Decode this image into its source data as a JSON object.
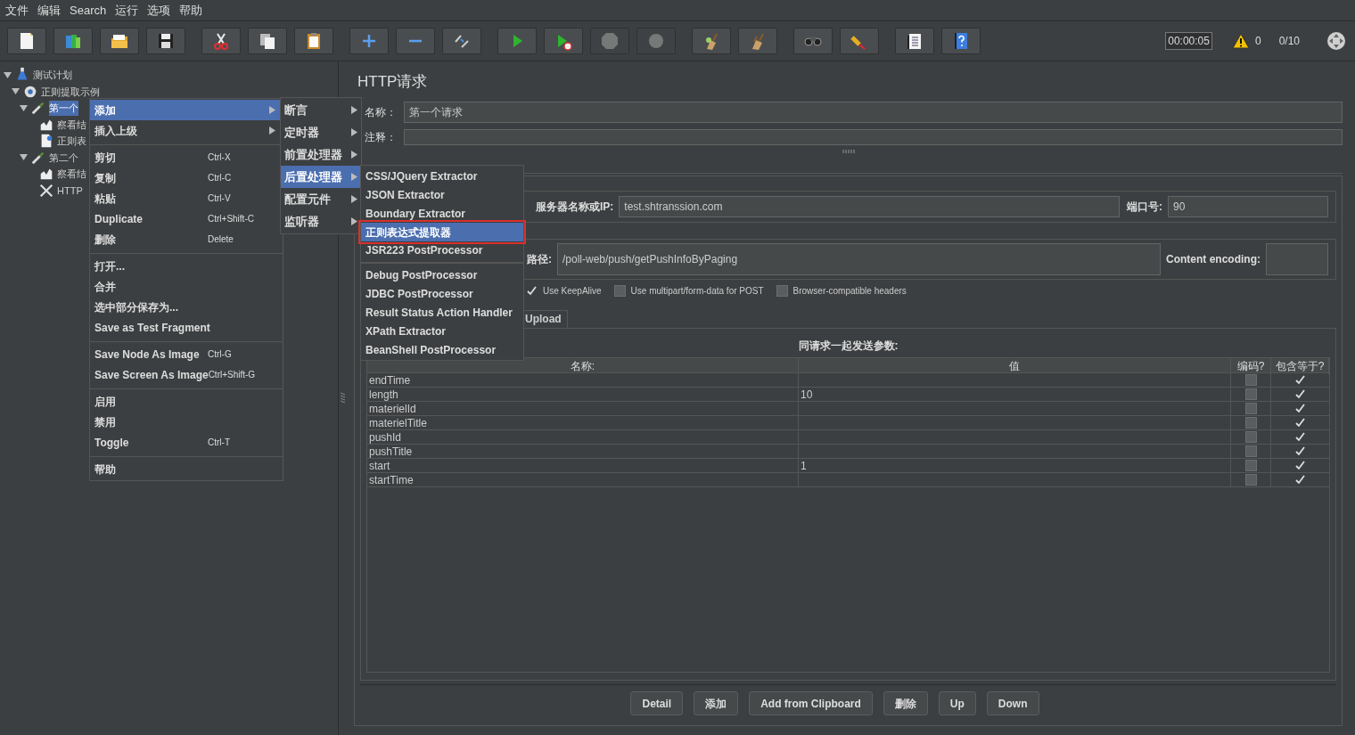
{
  "menu_bar": [
    {
      "label": "文件"
    },
    {
      "label": "编辑"
    },
    {
      "label": "Search"
    },
    {
      "label": "运行"
    },
    {
      "label": "选项"
    },
    {
      "label": "帮助"
    }
  ],
  "toolbar": [
    [
      {
        "kind": "new",
        "disabled": false
      },
      {
        "kind": "templates",
        "disabled": false
      },
      {
        "kind": "open",
        "disabled": false
      },
      {
        "kind": "save",
        "disabled": false
      }
    ],
    [
      {
        "kind": "cut",
        "disabled": false
      },
      {
        "kind": "copy",
        "disabled": false
      },
      {
        "kind": "paste",
        "disabled": false
      }
    ],
    [
      {
        "kind": "expand",
        "disabled": false
      },
      {
        "kind": "collapse",
        "disabled": false
      },
      {
        "kind": "toggle",
        "disabled": false
      }
    ],
    [
      {
        "kind": "start",
        "disabled": false
      },
      {
        "kind": "start-no-timers",
        "disabled": false
      },
      {
        "kind": "stop",
        "disabled": true
      },
      {
        "kind": "shutdown",
        "disabled": true
      }
    ],
    [
      {
        "kind": "clear",
        "disabled": false
      },
      {
        "kind": "clear-all",
        "disabled": false
      }
    ],
    [
      {
        "kind": "search",
        "disabled": false
      },
      {
        "kind": "reset",
        "disabled": false
      }
    ],
    [
      {
        "kind": "functions",
        "disabled": false
      },
      {
        "kind": "help",
        "disabled": false
      }
    ]
  ],
  "status": {
    "timer": "00:00:05",
    "warnings": "0",
    "threads": "0/10"
  },
  "tree": [
    {
      "label": "测试计划",
      "kind": "plan",
      "expanded": true,
      "selected": false,
      "children": [
        {
          "label": "正则提取示例",
          "kind": "thread-group",
          "expanded": true,
          "selected": false,
          "children": [
            {
              "label": "第一个",
              "kind": "sampler",
              "expanded": true,
              "selected": true,
              "children": [
                {
                  "label": "察看结",
                  "kind": "listener",
                  "selected": false
                },
                {
                  "label": "正则表",
                  "kind": "extractor",
                  "selected": false
                }
              ]
            },
            {
              "label": "第二个",
              "kind": "sampler",
              "expanded": true,
              "selected": false,
              "children": [
                {
                  "label": "察看结",
                  "kind": "listener",
                  "selected": false
                },
                {
                  "label": "HTTP",
                  "kind": "config",
                  "selected": false
                }
              ]
            }
          ]
        }
      ]
    }
  ],
  "context_menu": [
    {
      "kind": "submenu",
      "label": "添加",
      "selected": true
    },
    {
      "kind": "submenu",
      "label": "插入上级",
      "selected": false
    },
    {
      "kind": "separator"
    },
    {
      "kind": "item",
      "label": "剪切",
      "shortcut": "Ctrl-X",
      "selected": false
    },
    {
      "kind": "item",
      "label": "复制",
      "shortcut": "Ctrl-C",
      "selected": false
    },
    {
      "kind": "item",
      "label": "粘贴",
      "shortcut": "Ctrl-V",
      "selected": false
    },
    {
      "kind": "item",
      "label": "Duplicate",
      "shortcut": "Ctrl+Shift-C",
      "selected": false
    },
    {
      "kind": "item",
      "label": "删除",
      "shortcut": "Delete",
      "selected": false
    },
    {
      "kind": "separator"
    },
    {
      "kind": "item",
      "label": "打开...",
      "selected": false
    },
    {
      "kind": "item",
      "label": "合并",
      "selected": false
    },
    {
      "kind": "item",
      "label": "选中部分保存为...",
      "selected": false
    },
    {
      "kind": "item",
      "label": "Save as Test Fragment",
      "selected": false
    },
    {
      "kind": "separator"
    },
    {
      "kind": "item",
      "label": "Save Node As Image",
      "shortcut": "Ctrl-G",
      "selected": false
    },
    {
      "kind": "item",
      "label": "Save Screen As Image",
      "shortcut": "Ctrl+Shift-G",
      "selected": false
    },
    {
      "kind": "separator"
    },
    {
      "kind": "item",
      "label": "启用",
      "selected": false
    },
    {
      "kind": "item",
      "label": "禁用",
      "selected": false
    },
    {
      "kind": "item",
      "label": "Toggle",
      "shortcut": "Ctrl-T",
      "selected": false
    },
    {
      "kind": "separator"
    },
    {
      "kind": "item",
      "label": "帮助",
      "selected": false
    }
  ],
  "add_submenu": [
    {
      "label": "断言",
      "selected": false
    },
    {
      "label": "定时器",
      "selected": false
    },
    {
      "label": "前置处理器",
      "selected": false
    },
    {
      "label": "后置处理器",
      "selected": true
    },
    {
      "label": "配置元件",
      "selected": false
    },
    {
      "label": "监听器",
      "selected": false
    }
  ],
  "post_processor_menu": [
    {
      "label": "CSS/JQuery Extractor",
      "selected": false,
      "annotated": false
    },
    {
      "label": "JSON Extractor",
      "selected": false,
      "annotated": false
    },
    {
      "label": "Boundary Extractor",
      "selected": false,
      "annotated": false
    },
    {
      "label": "正则表达式提取器",
      "selected": true,
      "annotated": true
    },
    {
      "label": "JSR223 PostProcessor",
      "selected": false,
      "annotated": false,
      "separator_after": true
    },
    {
      "label": "Debug PostProcessor",
      "selected": false,
      "annotated": false
    },
    {
      "label": "JDBC PostProcessor",
      "selected": false,
      "annotated": false
    },
    {
      "label": "Result Status Action Handler",
      "selected": false,
      "annotated": false
    },
    {
      "label": "XPath Extractor",
      "selected": false,
      "annotated": false
    },
    {
      "label": "BeanShell PostProcessor",
      "selected": false,
      "annotated": false
    }
  ],
  "editor": {
    "title": "HTTP请求",
    "name_label": "名称：",
    "name_value": "第一个请求",
    "comment_label": "注释：",
    "server_label": "服务器名称或IP:",
    "server_value": "test.shtranssion.com",
    "port_label": "端口号:",
    "port_value": "90",
    "path_label": "路径:",
    "path_value": "/poll-web/push/getPushInfoByPaging",
    "encoding_label": "Content encoding:",
    "options": [
      {
        "label": "Use KeepAlive",
        "checked": true
      },
      {
        "label": "Use multipart/form-data for POST",
        "checked": false
      },
      {
        "label": "Browser-compatible headers",
        "checked": false
      }
    ],
    "tabs": [
      {
        "label": "Upload",
        "selected": false
      }
    ],
    "params_title": "同请求一起发送参数:",
    "columns": [
      "名称:",
      "值",
      "编码?",
      "包含等于?"
    ],
    "rows": [
      {
        "name": "endTime",
        "value": "",
        "encode": false,
        "include_equals": true
      },
      {
        "name": "length",
        "value": "10",
        "encode": false,
        "include_equals": true
      },
      {
        "name": "materielId",
        "value": "",
        "encode": false,
        "include_equals": true
      },
      {
        "name": "materielTitle",
        "value": "",
        "encode": false,
        "include_equals": true
      },
      {
        "name": "pushId",
        "value": "",
        "encode": false,
        "include_equals": true
      },
      {
        "name": "pushTitle",
        "value": "",
        "encode": false,
        "include_equals": true
      },
      {
        "name": "start",
        "value": "1",
        "encode": false,
        "include_equals": true
      },
      {
        "name": "startTime",
        "value": "",
        "encode": false,
        "include_equals": true
      }
    ],
    "buttons": [
      "Detail",
      "添加",
      "Add from Clipboard",
      "删除",
      "Up",
      "Down"
    ]
  }
}
